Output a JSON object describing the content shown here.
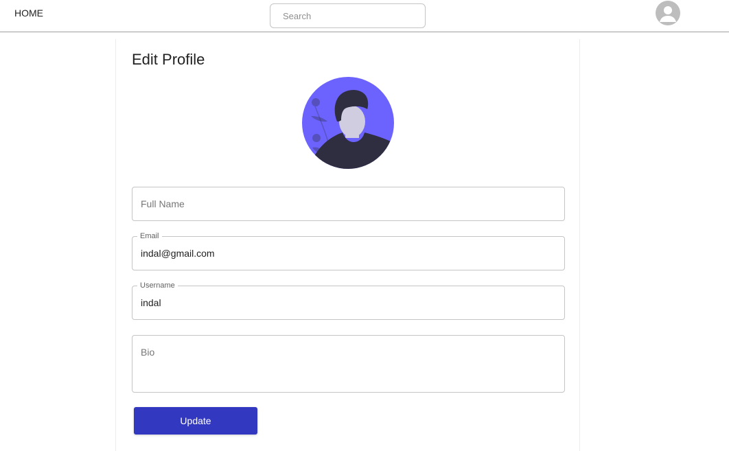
{
  "topbar": {
    "home_label": "HOME",
    "search_placeholder": "Search",
    "avatar_icon": "account-circle-icon"
  },
  "profile": {
    "title": "Edit Profile",
    "picture": "person-avatar-illustration",
    "fields": {
      "full_name": {
        "placeholder": "Full Name",
        "value": ""
      },
      "email": {
        "label": "Email",
        "value": "indal@gmail.com"
      },
      "username": {
        "label": "Username",
        "value": "indal"
      },
      "bio": {
        "placeholder": "Bio",
        "value": ""
      }
    },
    "update_label": "Update"
  },
  "colors": {
    "accent": "#3338c0",
    "avatar_bg": "#6c63ff",
    "illustration_dark": "#2f2e41",
    "face": "#d0cde1",
    "border": "#c4c4c4"
  }
}
